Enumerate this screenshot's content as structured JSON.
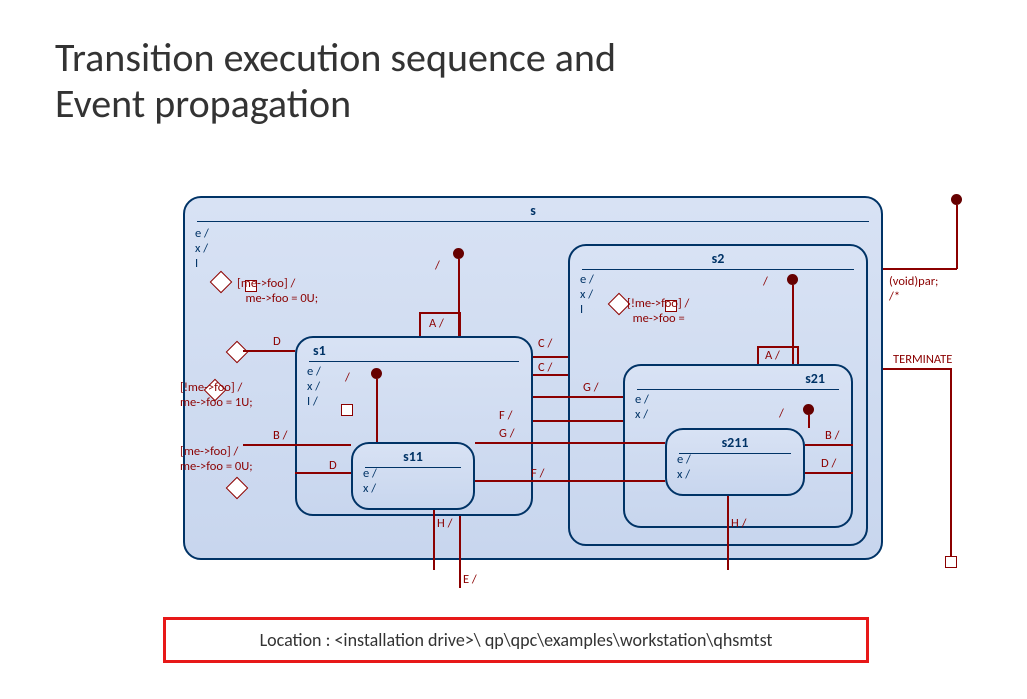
{
  "title_line1": "Transition execution sequence and",
  "title_line2": "Event propagation",
  "location_text": "Location : <installation drive>\\ qp\\qpc\\examples\\workstation\\qhsmtst",
  "states": {
    "s": {
      "name": "s",
      "entry": "e /\nx /\nI"
    },
    "s1": {
      "name": "s1",
      "entry": "e /\nx /\nI /"
    },
    "s11": {
      "name": "s11",
      "entry": "e /\nx /"
    },
    "s2": {
      "name": "s2",
      "entry": "e /\nx /\nI"
    },
    "s21": {
      "name": "s21",
      "entry": "e /\nx /"
    },
    "s211": {
      "name": "s211",
      "entry": "e /\nx /"
    }
  },
  "guards": {
    "g1": "[me->foo] /\n   me->foo = 0U;",
    "g2": "[!me->foo] /\nme->foo = 1U;",
    "g3": "[me->foo] /\nme->foo = 0U;",
    "g4": "[!me->foo] /\n  me->foo ="
  },
  "labels": {
    "A1": "A /",
    "A2": "A /",
    "B1": "B /",
    "B2": "B /",
    "C1": "C /",
    "C2": "C /",
    "D1": "D",
    "D2": "D",
    "D3": "D /",
    "E": "E /",
    "F1": "F /",
    "F2": "F /",
    "G1": "G /",
    "G2": "G /",
    "H1": "H /",
    "H2": "H /",
    "slash1": "/",
    "slash2": "/",
    "slash3": "/",
    "slash4": "/",
    "terminate": "TERMINATE",
    "voidpar": "(void)par; /*"
  }
}
